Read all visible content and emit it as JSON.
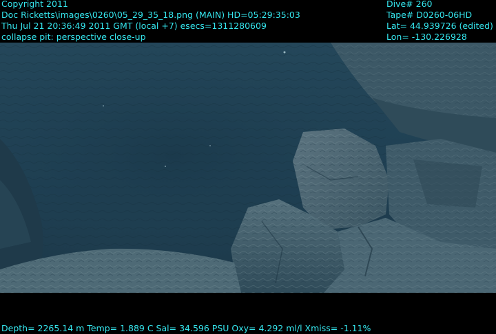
{
  "overlay": {
    "top_left": {
      "copyright": "Copyright 2011",
      "image_path": "Doc Ricketts\\images\\0260\\05_29_35_18.png (MAIN)  HD=05:29:35:03",
      "datetime": "Thu Jul 21 20:36:49 2011 GMT (local +7)  esecs=1311280609",
      "description": "collapse pit: perspective close-up"
    },
    "top_right": {
      "dive": "Dive# 260",
      "tape": "Tape# D0260-06HD",
      "lat": "Lat= 44.939726 (edited)",
      "lon": "Lon= -130.226928"
    },
    "bottom": {
      "sensors": "Depth= 2265.14 m  Temp= 1.889 C  Sal= 34.596 PSU  Oxy= 4.292 ml/l  Xmiss= -1.11%"
    }
  },
  "colors": {
    "overlay_text": "#35e6ee",
    "background": "#000000"
  }
}
